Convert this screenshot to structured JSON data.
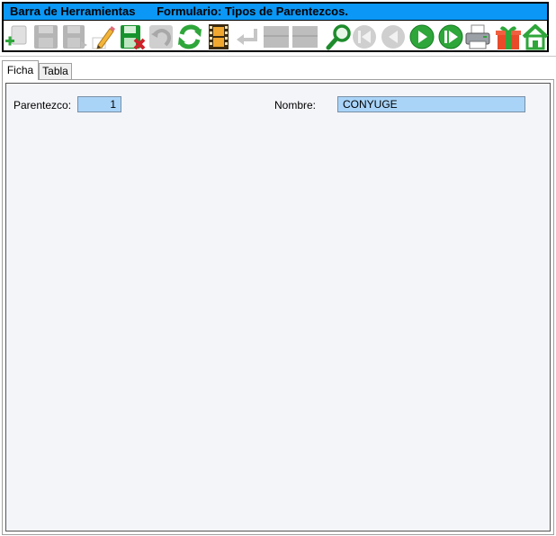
{
  "toolbar": {
    "title": "Barra de Herramientas",
    "form_title": "Formulario: Tipos de Parentezcos.",
    "icons": [
      {
        "name": "add-record-icon",
        "enabled": true
      },
      {
        "name": "save-icon",
        "enabled": false
      },
      {
        "name": "save-as-icon",
        "enabled": false
      },
      {
        "name": "edit-pencil-icon",
        "enabled": true
      },
      {
        "name": "save-delete-icon",
        "enabled": true
      },
      {
        "name": "undo-icon",
        "enabled": false
      },
      {
        "name": "refresh-icon",
        "enabled": true
      },
      {
        "name": "film-strip-icon",
        "enabled": true
      },
      {
        "name": "return-arrow-icon",
        "enabled": false
      },
      {
        "name": "grid-disabled-icon",
        "enabled": false
      },
      {
        "name": "grid-disabled-icon-2",
        "enabled": false
      },
      {
        "name": "search-magnifier-icon",
        "enabled": true
      },
      {
        "name": "first-record-icon",
        "enabled": false
      },
      {
        "name": "previous-record-icon",
        "enabled": false
      },
      {
        "name": "next-record-icon",
        "enabled": true
      },
      {
        "name": "last-record-icon",
        "enabled": true
      },
      {
        "name": "printer-icon",
        "enabled": true
      },
      {
        "name": "gift-icon",
        "enabled": true
      },
      {
        "name": "home-icon",
        "enabled": true
      }
    ]
  },
  "tabs": [
    {
      "label": "Ficha",
      "active": true
    },
    {
      "label": "Tabla",
      "active": false
    }
  ],
  "form": {
    "parentezco_label": "Parentezco:",
    "parentezco_value": "1",
    "nombre_label": "Nombre:",
    "nombre_value": "CONYUGE"
  },
  "colors": {
    "title_bar": "#0a97f5",
    "field_bg": "#a9d4f8",
    "panel_bg": "#f4f5f9"
  }
}
